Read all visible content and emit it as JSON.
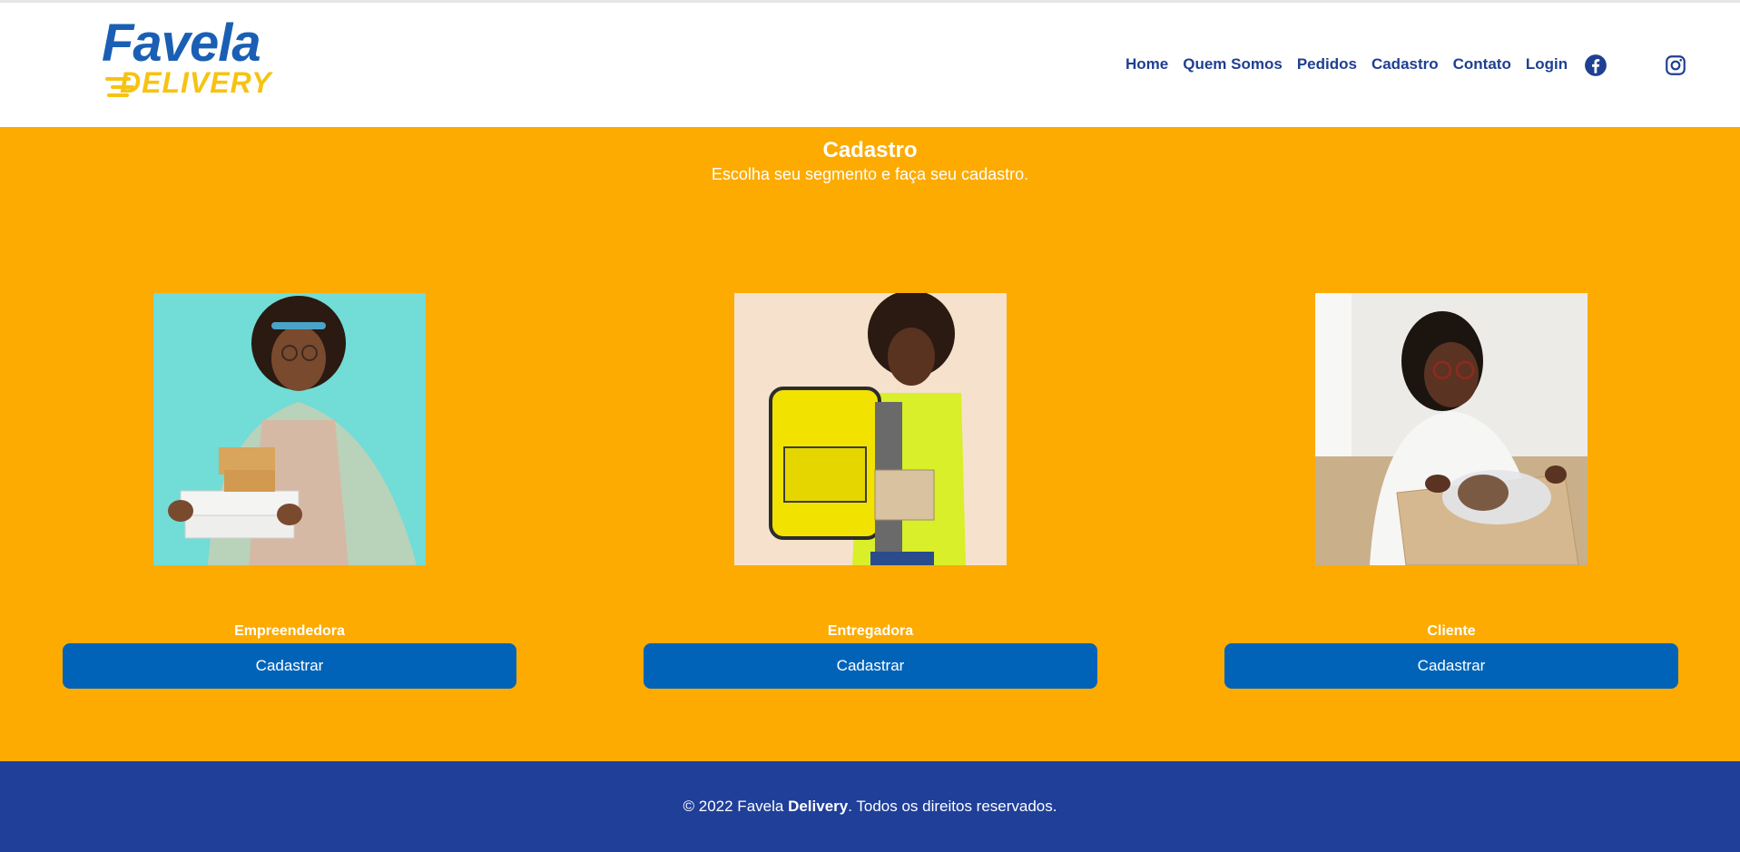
{
  "brand": {
    "name_top": "Favela",
    "name_bottom": "DELIVERY",
    "primary_color": "#1a5fb4",
    "accent_color": "#f6c312"
  },
  "nav": {
    "items": [
      {
        "label": "Home"
      },
      {
        "label": "Quem Somos"
      },
      {
        "label": "Pedidos"
      },
      {
        "label": "Cadastro"
      },
      {
        "label": "Contato"
      },
      {
        "label": "Login"
      }
    ],
    "social": [
      {
        "icon": "facebook-icon"
      },
      {
        "icon": "instagram-icon"
      }
    ]
  },
  "section": {
    "title": "Cadastro",
    "subtitle": "Escolha seu segmento e faça seu cadastro.",
    "background": "#fdab00"
  },
  "cards": [
    {
      "label": "Empreendedora",
      "button": "Cadastrar",
      "photo_bg": "#72dcd6"
    },
    {
      "label": "Entregadora",
      "button": "Cadastrar",
      "photo_bg": "#f6e2cc"
    },
    {
      "label": "Cliente",
      "button": "Cadastrar",
      "photo_bg": "#ecebe8"
    }
  ],
  "button_color": "#0063b8",
  "footer": {
    "prefix": "© 2022 Favela ",
    "bold": "Delivery",
    "suffix": ". Todos os direitos reservados.",
    "background": "#1f3f99"
  }
}
